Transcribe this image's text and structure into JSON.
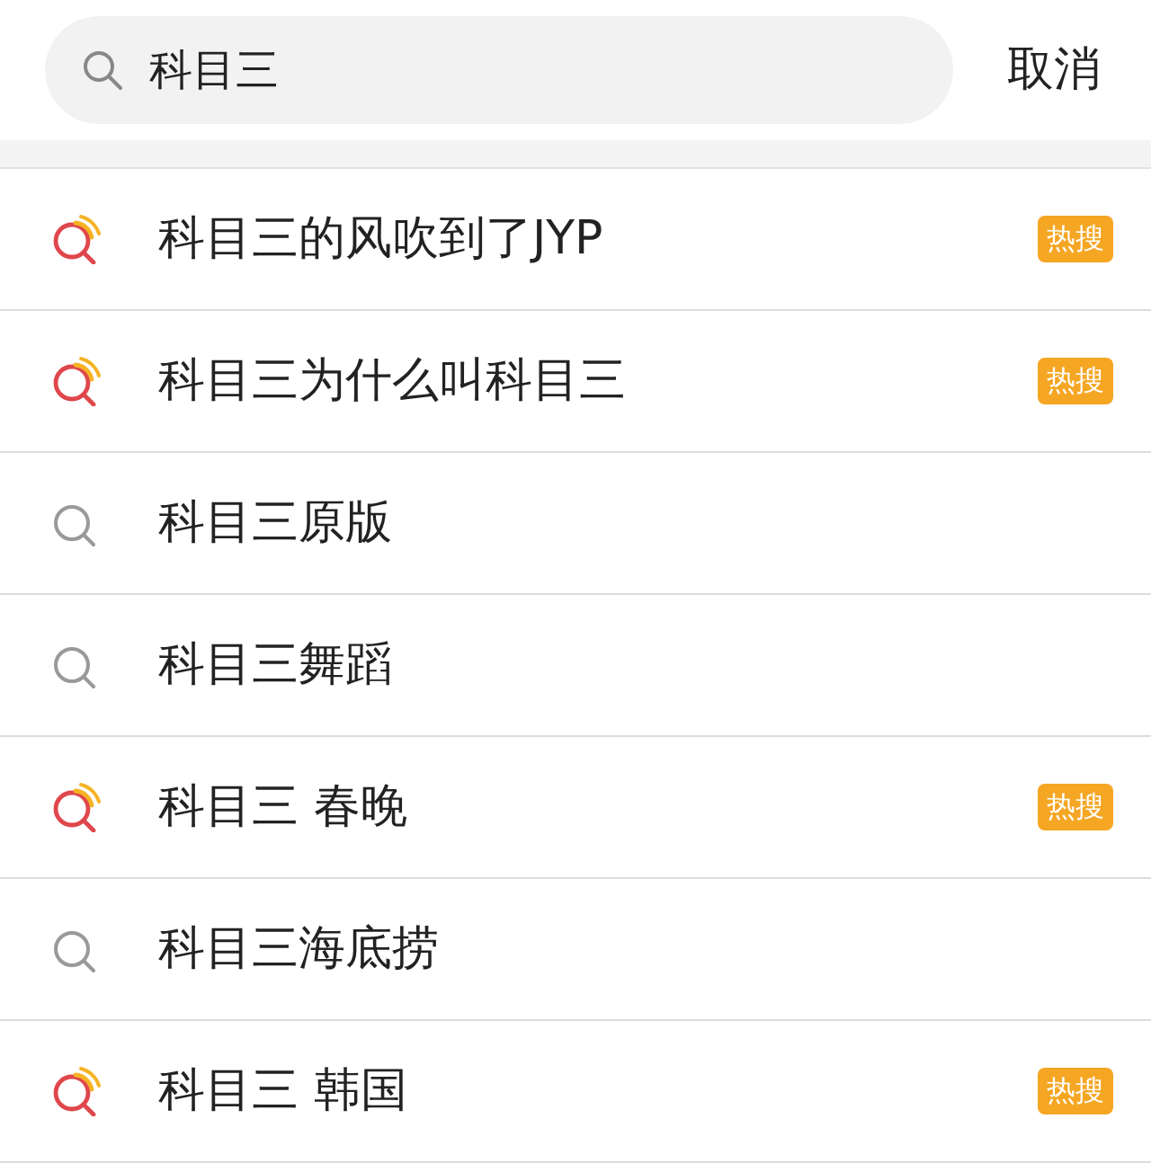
{
  "search": {
    "value": "科目三"
  },
  "cancel": "取消",
  "suggestions": [
    {
      "text": "科目三的风吹到了JYP",
      "kind": "hot",
      "badge": "热搜"
    },
    {
      "text": "科目三为什么叫科目三",
      "kind": "hot",
      "badge": "热搜"
    },
    {
      "text": "科目三原版",
      "kind": "normal"
    },
    {
      "text": "科目三舞蹈",
      "kind": "normal"
    },
    {
      "text": "科目三 春晚",
      "kind": "hot",
      "badge": "热搜"
    },
    {
      "text": "科目三海底捞",
      "kind": "normal"
    },
    {
      "text": "科目三 韩国",
      "kind": "hot",
      "badge": "热搜"
    }
  ]
}
